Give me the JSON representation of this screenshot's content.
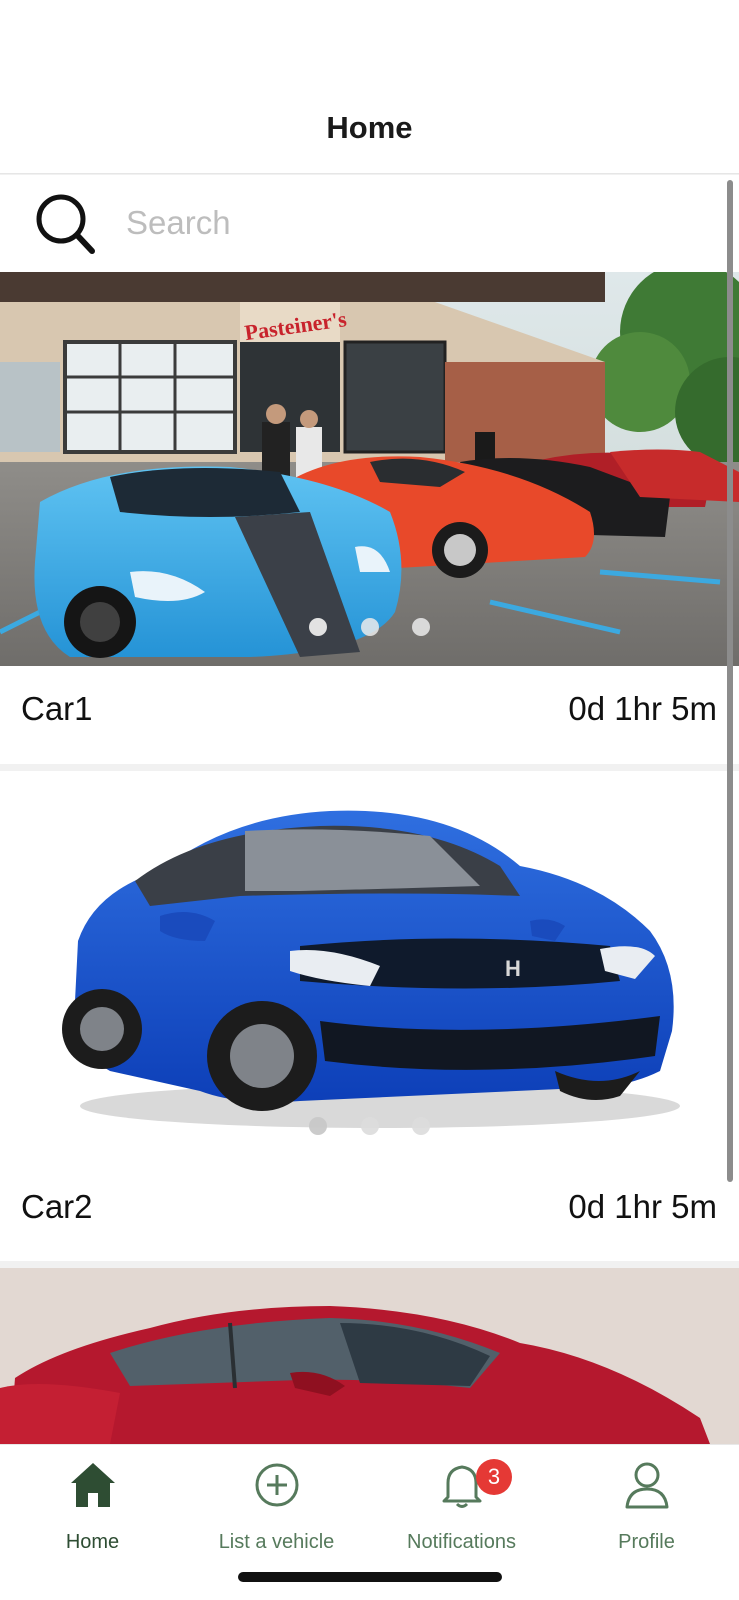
{
  "header": {
    "title": "Home"
  },
  "search": {
    "placeholder": "Search",
    "icon": "search-icon"
  },
  "listings": [
    {
      "name": "Car1",
      "time_left": "0d 1hr 5m",
      "image": "car-show-photo",
      "carousel_pages": 3,
      "carousel_active": 1
    },
    {
      "name": "Car2",
      "time_left": "0d 1hr 5m",
      "image": "blue-sedan-photo",
      "carousel_pages": 3,
      "carousel_active": 1
    },
    {
      "image": "red-sedan-photo"
    }
  ],
  "tabbar": {
    "items": [
      {
        "label": "Home",
        "icon": "home-icon",
        "active": true
      },
      {
        "label": "List a vehicle",
        "icon": "plus-circle-icon",
        "active": false
      },
      {
        "label": "Notifications",
        "icon": "bell-icon",
        "active": false,
        "badge": "3"
      },
      {
        "label": "Profile",
        "icon": "person-icon",
        "active": false
      }
    ]
  },
  "colors": {
    "accent": "#2e4d33",
    "tab_inactive": "#567a5c",
    "badge": "#e53935"
  }
}
